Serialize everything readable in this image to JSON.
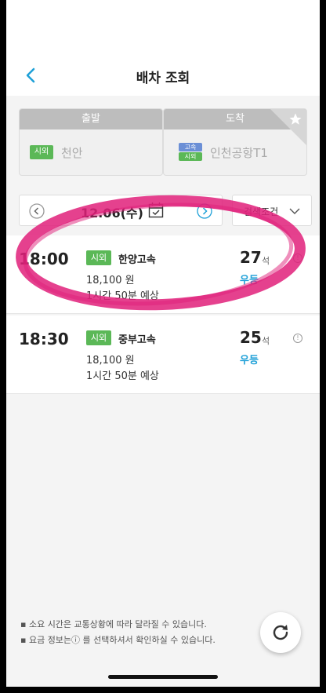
{
  "header": {
    "title": "배차 조회",
    "back_icon": "chevron-left-icon"
  },
  "route": {
    "departure": {
      "label": "출발",
      "tag": "시외",
      "city": "천안"
    },
    "arrival": {
      "label": "도착",
      "tags": [
        "고속",
        "시외"
      ],
      "city": "인천공항T1",
      "favorite_icon": "star-icon"
    }
  },
  "date_bar": {
    "date": "12.06(수)",
    "prev_icon": "chevron-left-circle-icon",
    "next_icon": "chevron-right-circle-icon",
    "calendar_icon": "calendar-icon"
  },
  "filter": {
    "label": "검색조건"
  },
  "schedules": [
    {
      "time": "18:00",
      "tag": "시외",
      "company": "한양고속",
      "fare": "18,100 원",
      "duration": "1시간 50분 예상",
      "seats": "27",
      "seat_unit": "석",
      "grade": "우등",
      "info": "!"
    },
    {
      "time": "18:30",
      "tag": "시외",
      "company": "중부고속",
      "fare": "18,100 원",
      "duration": "1시간 50분 예상",
      "seats": "25",
      "seat_unit": "석",
      "grade": "우등",
      "info": "!"
    }
  ],
  "notes": [
    "소요 시간은 교통상황에 따라 달라질 수 있습니다.",
    "요금 정보는ⓘ 를 선택하셔서 확인하실 수 있습니다."
  ],
  "colors": {
    "accent": "#1ea0d7",
    "tag_green": "#5bb857",
    "highlight": "#e0207a"
  }
}
